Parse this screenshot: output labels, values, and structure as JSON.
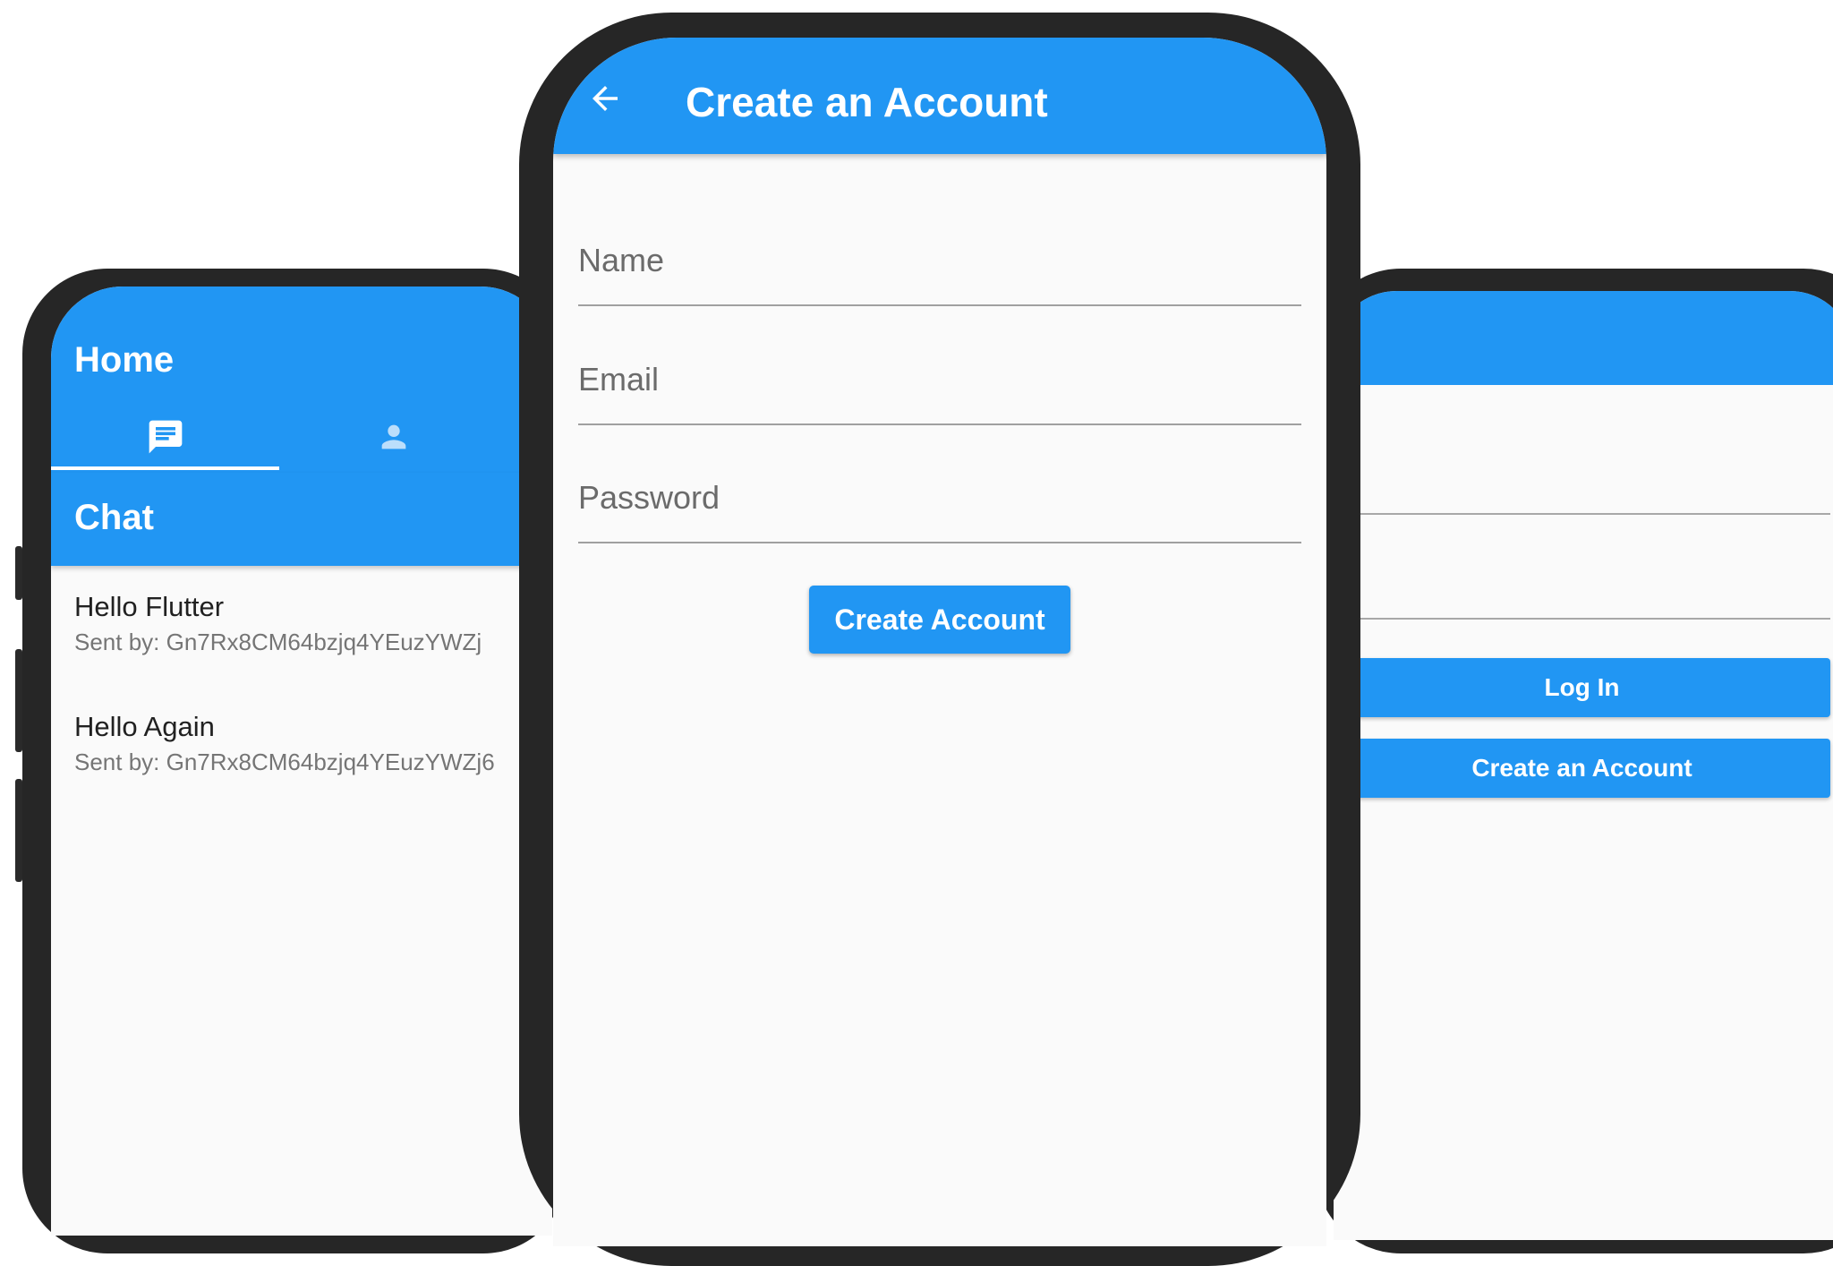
{
  "left_phone": {
    "appbar_title": "Home",
    "tabs": [
      {
        "icon": "chat-icon",
        "selected": true
      },
      {
        "icon": "person-icon",
        "selected": false
      }
    ],
    "section_title": "Chat",
    "messages": [
      {
        "text": "Hello Flutter",
        "sender": "Sent by: Gn7Rx8CM64bzjq4YEuzYWZj"
      },
      {
        "text": "Hello Again",
        "sender": "Sent by: Gn7Rx8CM64bzjq4YEuzYWZj6"
      }
    ]
  },
  "center_phone": {
    "appbar_title": "Create an Account",
    "back_icon": "arrow-back-icon",
    "fields": {
      "name_placeholder": "Name",
      "email_placeholder": "Email",
      "password_placeholder": "Password"
    },
    "submit_label": "Create Account"
  },
  "right_phone": {
    "login_label": "Log In",
    "create_label": "Create an Account"
  },
  "colors": {
    "primary": "#2196f3",
    "frame": "#262626",
    "background": "#fafafa"
  }
}
